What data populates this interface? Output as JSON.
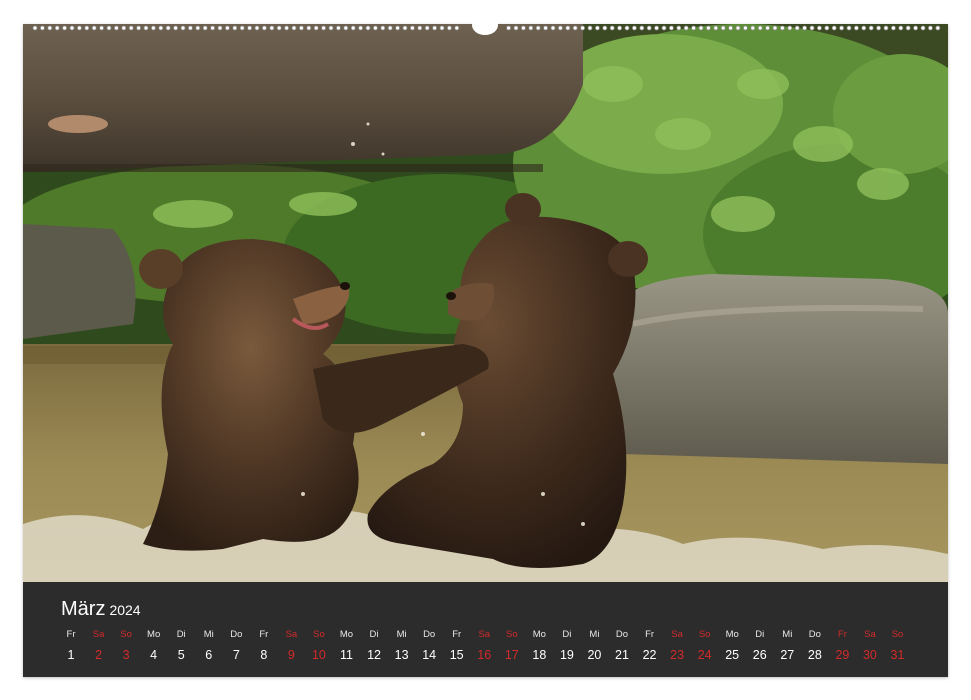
{
  "calendar": {
    "month": "März",
    "year": "2024",
    "days": [
      {
        "dow": "Fr",
        "day": "1",
        "weekend": false
      },
      {
        "dow": "Sa",
        "day": "2",
        "weekend": true
      },
      {
        "dow": "So",
        "day": "3",
        "weekend": true
      },
      {
        "dow": "Mo",
        "day": "4",
        "weekend": false
      },
      {
        "dow": "Di",
        "day": "5",
        "weekend": false
      },
      {
        "dow": "Mi",
        "day": "6",
        "weekend": false
      },
      {
        "dow": "Do",
        "day": "7",
        "weekend": false
      },
      {
        "dow": "Fr",
        "day": "8",
        "weekend": false
      },
      {
        "dow": "Sa",
        "day": "9",
        "weekend": true
      },
      {
        "dow": "So",
        "day": "10",
        "weekend": true
      },
      {
        "dow": "Mo",
        "day": "11",
        "weekend": false
      },
      {
        "dow": "Di",
        "day": "12",
        "weekend": false
      },
      {
        "dow": "Mi",
        "day": "13",
        "weekend": false
      },
      {
        "dow": "Do",
        "day": "14",
        "weekend": false
      },
      {
        "dow": "Fr",
        "day": "15",
        "weekend": false
      },
      {
        "dow": "Sa",
        "day": "16",
        "weekend": true
      },
      {
        "dow": "So",
        "day": "17",
        "weekend": true
      },
      {
        "dow": "Mo",
        "day": "18",
        "weekend": false
      },
      {
        "dow": "Di",
        "day": "19",
        "weekend": false
      },
      {
        "dow": "Mi",
        "day": "20",
        "weekend": false
      },
      {
        "dow": "Do",
        "day": "21",
        "weekend": false
      },
      {
        "dow": "Fr",
        "day": "22",
        "weekend": false
      },
      {
        "dow": "Sa",
        "day": "23",
        "weekend": true
      },
      {
        "dow": "So",
        "day": "24",
        "weekend": true
      },
      {
        "dow": "Mo",
        "day": "25",
        "weekend": false
      },
      {
        "dow": "Di",
        "day": "26",
        "weekend": false
      },
      {
        "dow": "Mi",
        "day": "27",
        "weekend": false
      },
      {
        "dow": "Do",
        "day": "28",
        "weekend": false
      },
      {
        "dow": "Fr",
        "day": "29",
        "weekend": true
      },
      {
        "dow": "Sa",
        "day": "30",
        "weekend": true
      },
      {
        "dow": "So",
        "day": "31",
        "weekend": true
      }
    ]
  },
  "colors": {
    "weekend": "#d42a2a",
    "weekday": "#ffffff",
    "panel": "#2c2c2c"
  },
  "photo": {
    "subject": "two brown bear cubs play-fighting in water"
  }
}
